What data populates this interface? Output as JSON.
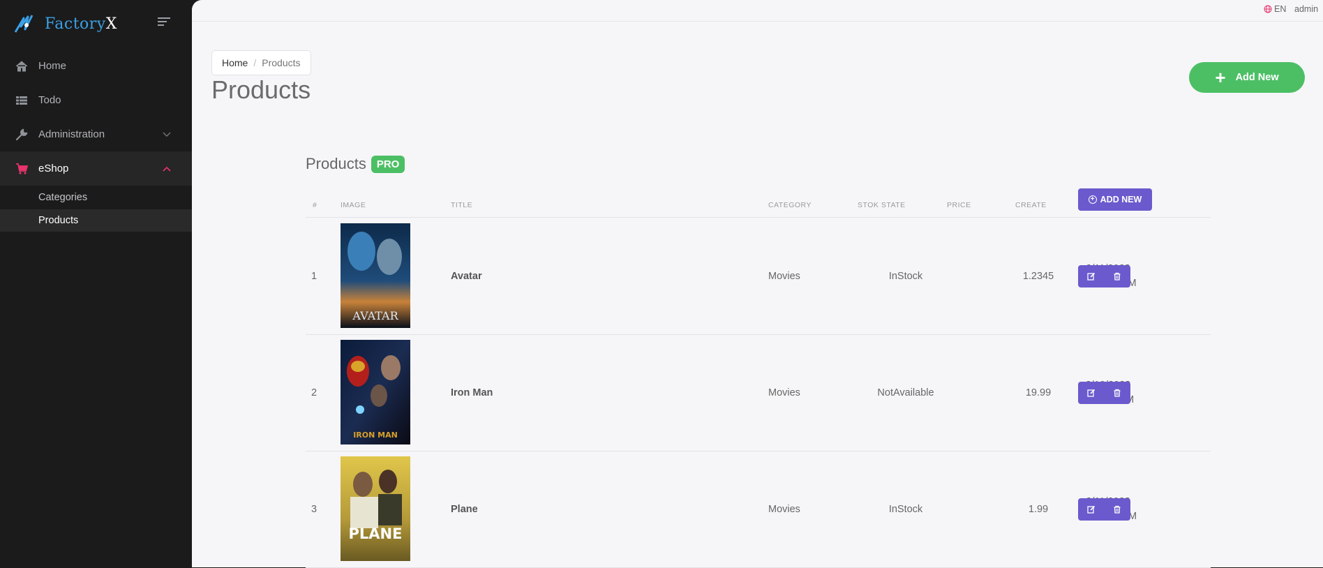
{
  "brand": {
    "name_prefix": "Factory",
    "name_suffix": "X"
  },
  "sidebar": {
    "items": [
      {
        "label": "Home",
        "icon": "home-icon"
      },
      {
        "label": "Todo",
        "icon": "list-icon"
      },
      {
        "label": "Administration",
        "icon": "wrench-icon"
      },
      {
        "label": "eShop",
        "icon": "cart-icon"
      }
    ],
    "sub_items": [
      {
        "label": "Categories"
      },
      {
        "label": "Products"
      }
    ],
    "accent_color": "#e8336d"
  },
  "topbar": {
    "language": "EN",
    "user": "admin"
  },
  "breadcrumb": {
    "home": "Home",
    "separator": "/",
    "current": "Products"
  },
  "page": {
    "title": "Products",
    "add_new_label": "Add New"
  },
  "card": {
    "title": "Products",
    "badge": "PRO"
  },
  "table": {
    "headers": {
      "index": "#",
      "image": "IMAGE",
      "title": "TITLE",
      "category": "CATEGORY",
      "stock": "STOK STATE",
      "price": "PRICE",
      "created": "CREATE"
    },
    "add_new_label": "ADD NEW",
    "rows": [
      {
        "index": "1",
        "image_text": "AVATAR",
        "title": "Avatar",
        "category": "Movies",
        "stock": "InStock",
        "price": "1.2345",
        "date": "2/11/2023",
        "time": "11:58:22 PM"
      },
      {
        "index": "2",
        "image_text": "IRON MAN",
        "title": "Iron Man",
        "category": "Movies",
        "stock": "NotAvailable",
        "price": "19.99",
        "date": "2/10/2023",
        "time": "5:32:22 PM"
      },
      {
        "index": "3",
        "image_text": "PLANE",
        "title": "Plane",
        "category": "Movies",
        "stock": "InStock",
        "price": "1.99",
        "date": "2/11/2023",
        "time": "10:17:02 PM"
      }
    ]
  },
  "colors": {
    "green": "#4cbf65",
    "purple": "#6a5acd",
    "sidebar_bg": "#1b1b1b"
  }
}
